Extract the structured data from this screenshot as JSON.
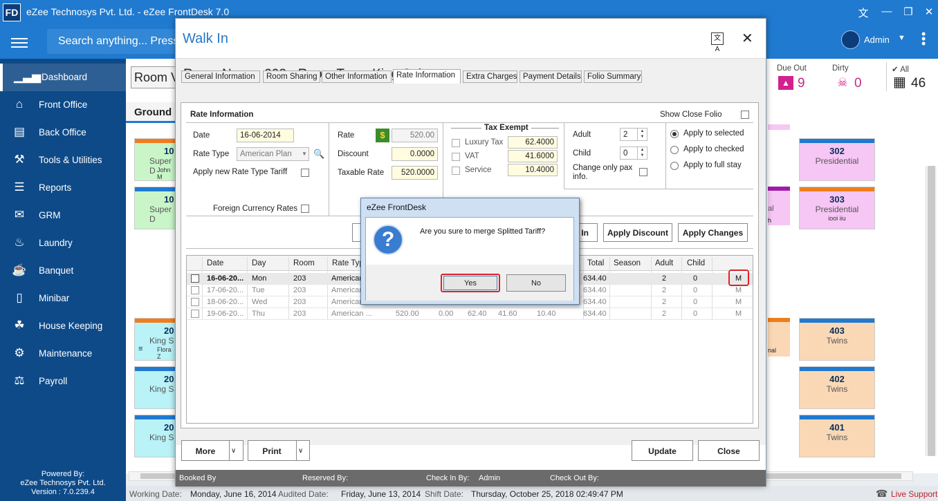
{
  "app": {
    "logo": "FD",
    "title": "eZee Technosys Pvt. Ltd. - eZee FrontDesk 7.0",
    "window_icons": [
      "translate-icon",
      "minimize-icon",
      "restore-icon",
      "close-icon"
    ]
  },
  "search": {
    "placeholder": "Search anything... Press"
  },
  "user": {
    "name": "Admin"
  },
  "sidebar": {
    "items": [
      {
        "label": "Dashboard",
        "icon": "dashboard-icon"
      },
      {
        "label": "Front Office",
        "icon": "front-office-icon"
      },
      {
        "label": "Back Office",
        "icon": "back-office-icon"
      },
      {
        "label": "Tools & Utilities",
        "icon": "tools-icon"
      },
      {
        "label": "Reports",
        "icon": "reports-icon"
      },
      {
        "label": "GRM",
        "icon": "grm-icon"
      },
      {
        "label": "Laundry",
        "icon": "laundry-icon"
      },
      {
        "label": "Banquet",
        "icon": "banquet-icon"
      },
      {
        "label": "Minibar",
        "icon": "minibar-icon"
      },
      {
        "label": "House Keeping",
        "icon": "housekeeping-icon"
      },
      {
        "label": "Maintenance",
        "icon": "maintenance-icon"
      },
      {
        "label": "Payroll",
        "icon": "payroll-icon"
      }
    ],
    "powered_by": "Powered By:",
    "company": "eZee Technosys Pvt. Ltd.",
    "version": "Version : 7.0.239.4"
  },
  "background": {
    "room_view_button": "Room V",
    "floor_label": "Ground",
    "stats": [
      {
        "label": "Due Out",
        "value": "9"
      },
      {
        "label": "Dirty",
        "value": "0"
      },
      {
        "label": "All",
        "value": "46"
      }
    ],
    "left_rooms": [
      {
        "num": "10",
        "type": "Super D",
        "guest": "John M"
      },
      {
        "num": "10",
        "type": "Super D",
        "guest": ""
      },
      {
        "num": "20",
        "type": "King S",
        "guest": "Flora Z"
      },
      {
        "num": "20",
        "type": "King S",
        "guest": ""
      },
      {
        "num": "20",
        "type": "King S",
        "guest": ""
      }
    ],
    "right_rooms": [
      {
        "num": "302",
        "type": "Presidential",
        "guest": ""
      },
      {
        "num": "303",
        "type": "Presidential",
        "guest": "iooi iiu"
      },
      {
        "num": "403",
        "type": "Twins",
        "guest": ""
      },
      {
        "num": "402",
        "type": "Twins",
        "guest": ""
      },
      {
        "num": "401",
        "type": "Twins",
        "guest": ""
      }
    ],
    "partial_labels": [
      "al",
      "h",
      "nal"
    ],
    "status": {
      "working_date_label": "Working Date:",
      "working_date": "Monday, June 16, 2014",
      "audited_date_label": "Audited Date:",
      "audited_date": "Friday, June 13, 2014",
      "shift_date_label": "Shift Date:",
      "shift_date": "Thursday, October 25, 2018 02:49:47 PM",
      "live_support": "Live Support"
    }
  },
  "walkin": {
    "title": "Walk In",
    "room_heading": "Room Name: 203 - Room Type: King Suite",
    "tabs": [
      "General Information",
      "Room Sharing",
      "Other Information",
      "Rate Information",
      "Extra Charges",
      "Payment Details",
      "Folio Summary"
    ],
    "rate_info_title": "Rate Information",
    "show_close_folio": "Show Close Folio",
    "date_label": "Date",
    "date_value": "16-06-2014",
    "rate_type_label": "Rate Type",
    "rate_type_value": "American Plan",
    "apply_new_rate": "Apply new Rate Type Tariff",
    "foreign_currency": "Foreign Currency Rates",
    "rate_label": "Rate",
    "rate_value": "520.00",
    "discount_label": "Discount",
    "discount_value": "0.0000",
    "taxable_label": "Taxable Rate",
    "taxable_value": "520.0000",
    "tax_exempt_title": "Tax Exempt",
    "taxes": [
      {
        "name": "Luxury Tax",
        "value": "62.4000"
      },
      {
        "name": "VAT",
        "value": "41.6000"
      },
      {
        "name": "Service",
        "value": "10.4000"
      }
    ],
    "adult_label": "Adult",
    "adult_value": "2",
    "child_label": "Child",
    "child_value": "0",
    "change_pax": "Change only pax info.",
    "apply_options": [
      "Apply to selected",
      "Apply to checked",
      "Apply to full stay"
    ],
    "btn_partial": "In",
    "btn_apply_discount": "Apply Discount",
    "btn_apply_changes": "Apply Changes",
    "grid_headers": [
      "Date",
      "Day",
      "Room",
      "Rate Typ",
      "Total",
      "Season",
      "Adult",
      "Child"
    ],
    "rows": [
      {
        "date": "16-06-20...",
        "day": "Mon",
        "room": "203",
        "rate_type": "American",
        "rate": "",
        "disc": "",
        "tax1": "",
        "tax2": "",
        "tax3": "",
        "total": "634.40",
        "adult": "2",
        "child": "0",
        "flag": "M"
      },
      {
        "date": "17-06-20...",
        "day": "Tue",
        "room": "203",
        "rate_type": "American",
        "rate": "",
        "disc": "",
        "tax1": "",
        "tax2": "",
        "tax3": "",
        "total": "634.40",
        "adult": "2",
        "child": "0",
        "flag": "M"
      },
      {
        "date": "18-06-20...",
        "day": "Wed",
        "room": "203",
        "rate_type": "American",
        "rate": "",
        "disc": "",
        "tax1": "",
        "tax2": "",
        "tax3": "",
        "total": "634.40",
        "adult": "2",
        "child": "0",
        "flag": "M"
      },
      {
        "date": "19-06-20...",
        "day": "Thu",
        "room": "203",
        "rate_type": "American ...",
        "rate": "520.00",
        "disc": "0.00",
        "tax1": "62.40",
        "tax2": "41.60",
        "tax3": "10.40",
        "total": "634.40",
        "adult": "2",
        "child": "0",
        "flag": "M"
      }
    ],
    "btn_more": "More",
    "btn_print": "Print",
    "btn_update": "Update",
    "btn_close": "Close",
    "footer": {
      "booked_by": "Booked By",
      "reserved_by": "Reserved By:",
      "checkin_by": "Check In By:",
      "checkin_value": "Admin",
      "checkout_by": "Check Out By:"
    }
  },
  "msgbox": {
    "title": "eZee FrontDesk",
    "message": "Are you sure to merge Splitted Tariff?",
    "yes": "Yes",
    "no": "No"
  },
  "colors": {
    "accent": "#1f7ad0",
    "sidebar": "#0e4a88",
    "highlight_red": "#e0202a"
  }
}
